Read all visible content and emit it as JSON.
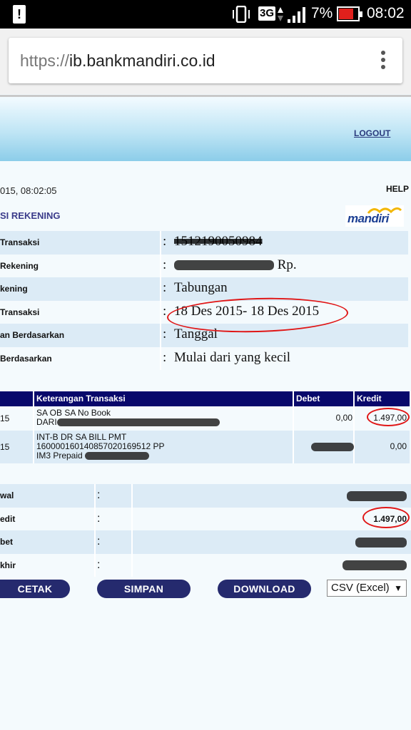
{
  "status_bar": {
    "battery_percent": "7%",
    "network": "3G",
    "time": "08:02"
  },
  "browser": {
    "url_protocol": "https://",
    "url_host": "ib.bankmandiri.co.id"
  },
  "header": {
    "logout": "LOGOUT"
  },
  "page": {
    "datetime": "015, 08:02:05",
    "help": "HELP",
    "section_title": "SI REKENING",
    "logo_text": "mandiri"
  },
  "info_rows": [
    {
      "label": "Transaksi",
      "value": "1512190050984"
    },
    {
      "label": "Rekening",
      "value": "Rp."
    },
    {
      "label": "kening",
      "value": "Tabungan"
    },
    {
      "label": "Transaksi",
      "value": "18 Des 2015- 18 Des 2015"
    },
    {
      "label": "an Berdasarkan",
      "value": "Tanggal"
    },
    {
      "label": "Berdasarkan",
      "value": "Mulai dari yang kecil"
    }
  ],
  "transactions": {
    "headers": {
      "description": "Keterangan Transaksi",
      "debit": "Debet",
      "credit": "Kredit"
    },
    "rows": [
      {
        "date": "15",
        "desc1": "SA OB SA No Book",
        "desc2": "DARI",
        "debit": "0,00",
        "credit": "1.497,00"
      },
      {
        "date": "15",
        "desc1": "INT-B DR SA BILL PMT",
        "desc2": "16000016014085702016951​2 PP",
        "desc3": "IM3 Prepaid",
        "debit": "",
        "credit": "0,00"
      }
    ]
  },
  "summary": [
    {
      "label": "wal",
      "amount": ""
    },
    {
      "label": "edit",
      "amount": "1.497,00"
    },
    {
      "label": "bet",
      "amount": ""
    },
    {
      "label": "khir",
      "amount": ""
    }
  ],
  "buttons": {
    "print": "CETAK",
    "save": "SIMPAN",
    "download": "DOWNLOAD"
  },
  "format_select": {
    "selected": "CSV (Excel)"
  }
}
